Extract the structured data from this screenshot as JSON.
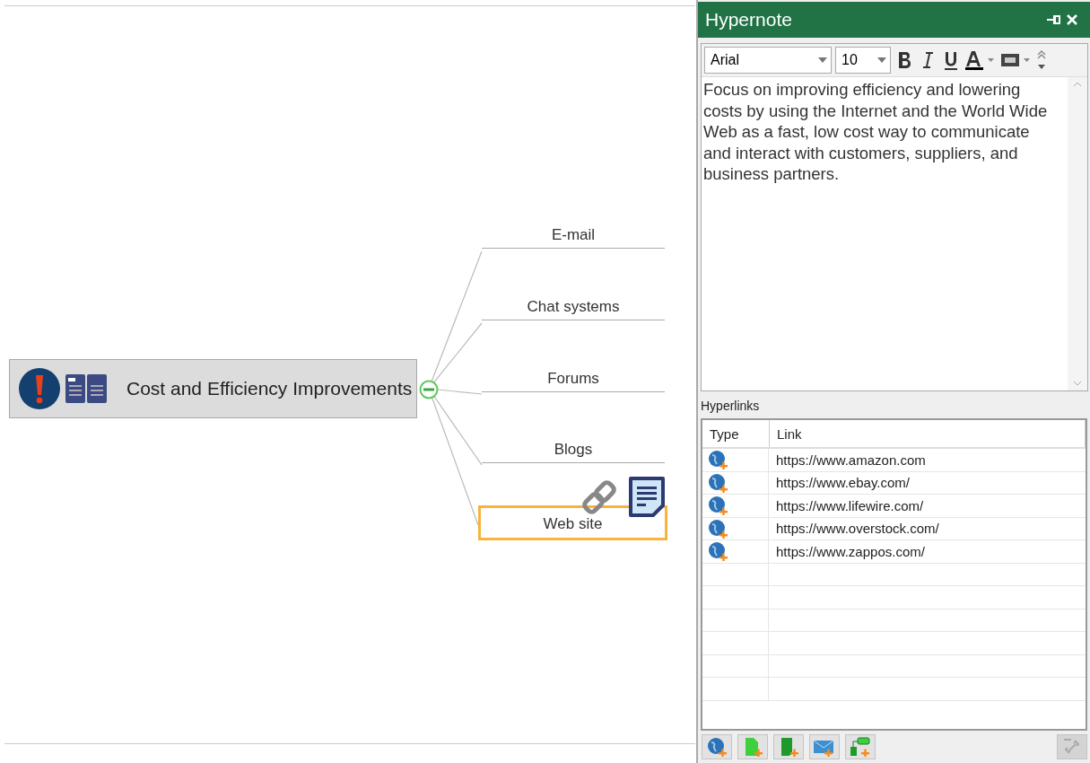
{
  "mindmap": {
    "central_topic": {
      "text": "Cost and Efficiency Improvements",
      "expanded": true
    },
    "branches": [
      {
        "text": "E-mail",
        "selected": false
      },
      {
        "text": "Chat systems",
        "selected": false
      },
      {
        "text": "Forums",
        "selected": false
      },
      {
        "text": "Blogs",
        "selected": false
      },
      {
        "text": "Web site",
        "selected": true
      }
    ]
  },
  "panel": {
    "title": "Hypernote",
    "toolbar": {
      "font": "Arial",
      "size": "10"
    },
    "note": "Focus on improving efficiency and lowering costs by using the Internet and the World Wide Web as a fast, low cost way to communicate and interact with customers, suppliers, and business partners.",
    "hyperlinks_label": "Hyperlinks",
    "columns": [
      "Type",
      "Link"
    ],
    "links": [
      "https://www.amazon.com",
      "https://www.ebay.com/",
      "https://www.lifewire.com/",
      "https://www.overstock.com/",
      "https://www.zappos.com/"
    ]
  }
}
